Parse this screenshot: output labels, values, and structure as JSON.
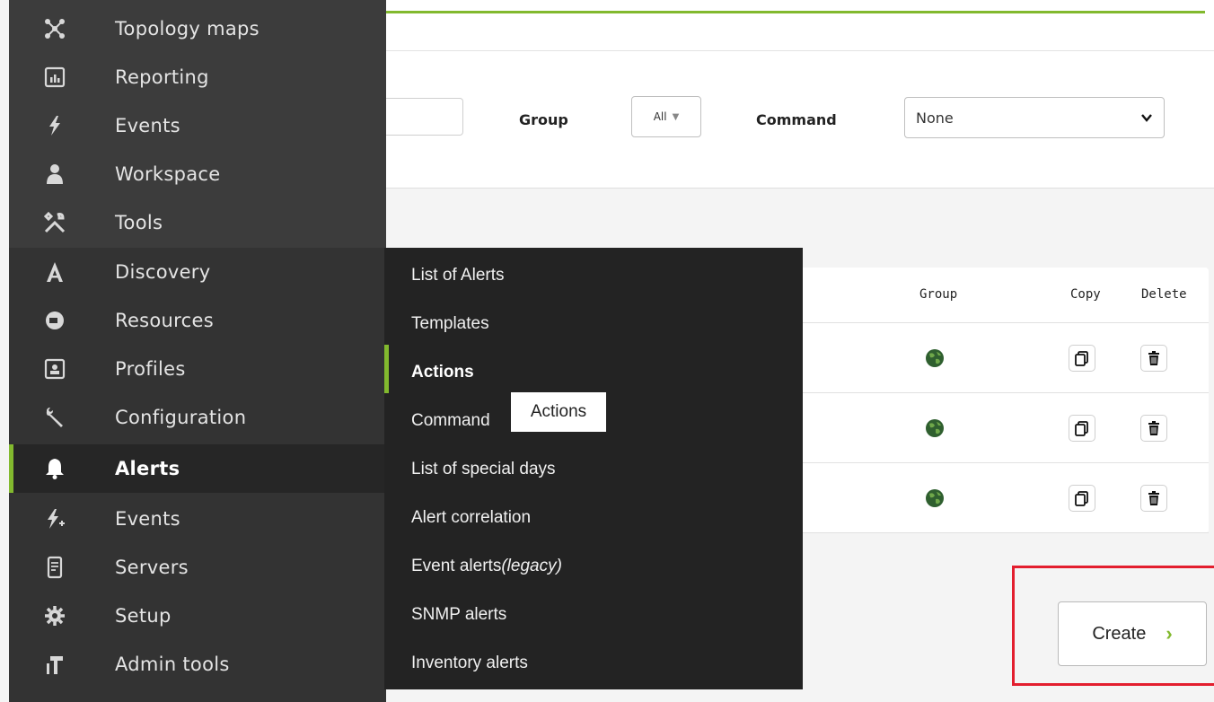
{
  "sidebar": {
    "items": [
      {
        "label": "Topology maps",
        "icon": "topology-icon"
      },
      {
        "label": "Reporting",
        "icon": "reporting-icon"
      },
      {
        "label": "Events",
        "icon": "events-icon"
      },
      {
        "label": "Workspace",
        "icon": "workspace-icon"
      },
      {
        "label": "Tools",
        "icon": "tools-icon"
      },
      {
        "label": "Discovery",
        "icon": "discovery-icon"
      },
      {
        "label": "Resources",
        "icon": "resources-icon"
      },
      {
        "label": "Profiles",
        "icon": "profiles-icon"
      },
      {
        "label": "Configuration",
        "icon": "wrench-icon"
      },
      {
        "label": "Alerts",
        "icon": "bell-icon",
        "active": true
      },
      {
        "label": "Events",
        "icon": "events-plus-icon"
      },
      {
        "label": "Servers",
        "icon": "server-icon"
      },
      {
        "label": "Setup",
        "icon": "gear-icon"
      },
      {
        "label": "Admin tools",
        "icon": "admin-tools-icon"
      }
    ]
  },
  "submenu": {
    "items": [
      {
        "label": "List of Alerts"
      },
      {
        "label": "Templates"
      },
      {
        "label": "Actions",
        "active": true
      },
      {
        "label": "Command"
      },
      {
        "label": "List of special days"
      },
      {
        "label": "Alert correlation"
      },
      {
        "label": "Event alerts",
        "suffix": "(legacy)"
      },
      {
        "label": "SNMP alerts"
      },
      {
        "label": "Inventory alerts"
      }
    ],
    "tooltip": "Actions"
  },
  "filters": {
    "group_label": "Group",
    "group_value": "All",
    "command_label": "Command",
    "command_value": "None"
  },
  "table": {
    "headers": {
      "group": "Group",
      "copy": "Copy",
      "delete": "Delete"
    },
    "rows": [
      {
        "group_icon": "globe-icon"
      },
      {
        "group_icon": "globe-icon"
      },
      {
        "group_icon": "globe-icon"
      }
    ]
  },
  "actions": {
    "create_label": "Create",
    "create_icon": "chevron-right-icon"
  },
  "colors": {
    "accent": "#82b92e",
    "highlight": "#e31e2e",
    "sidebar": "#3a3a3a",
    "submenu": "#232323"
  }
}
